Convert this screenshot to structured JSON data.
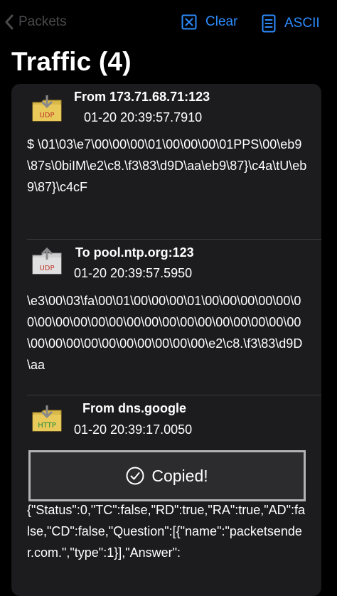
{
  "nav": {
    "back_label": "Packets",
    "clear_label": "Clear",
    "ascii_label": "ASCII"
  },
  "title": "Traffic (4)",
  "packets": [
    {
      "icon": "udp-download-icon",
      "icon_label": "UDP",
      "header": "From 173.71.68.71:123",
      "time": "01-20 20:39:57.7910",
      "data": "$ \\01\\03\\e7\\00\\00\\00\\01\\00\\00\\00\\01PPS\\00\\eb9\\87s\\0biIM\\e2\\c8.\\f3\\83\\d9D\\aa\\eb9\\87}\\c4a\\tU\\eb9\\87}\\c4cF"
    },
    {
      "icon": "udp-upload-icon",
      "icon_label": "UDP",
      "header": "To pool.ntp.org:123",
      "time": "01-20 20:39:57.5950",
      "data": "\\e3\\00\\03\\fa\\00\\01\\00\\00\\00\\01\\00\\00\\00\\00\\00\\00\\00\\00\\00\\00\\00\\00\\00\\00\\00\\00\\00\\00\\00\\00\\00\\00\\00\\00\\00\\00\\00\\00\\00\\00\\00\\e2\\c8.\\f3\\83\\d9D\\aa"
    },
    {
      "icon": "http-download-icon",
      "icon_label": "HTTP",
      "header": "From dns.google",
      "time": "01-20 20:39:17.0050",
      "data": "{\"Status\":0,\"TC\":false,\"RD\":true,\"RA\":true,\"AD\":false,\"CD\":false,\"Question\":[{\"name\":\"packetsender.com.\",\"type\":1}],\"Answer\":"
    }
  ],
  "toast": {
    "label": "Copied!"
  },
  "colors": {
    "accent": "#2d8cff",
    "background": "#000000",
    "card": "#1c1c1e",
    "udp_label": "#c0392b",
    "http_label": "#1e8a3a",
    "icon_folder": "#d9b84a"
  }
}
